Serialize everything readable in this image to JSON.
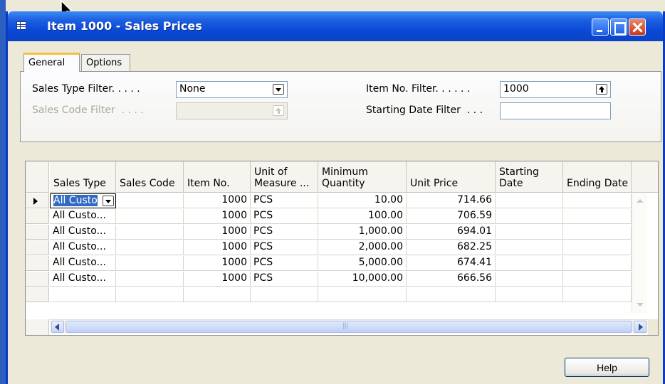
{
  "window": {
    "title": "Item 1000 - Sales Prices"
  },
  "tabs": [
    {
      "label": "General"
    },
    {
      "label": "Options"
    }
  ],
  "filters": {
    "sales_type_label": "Sales Type Filter. . . . .",
    "sales_type_value": "None",
    "sales_code_label": "Sales Code Filter  . . . .",
    "sales_code_value": "",
    "item_no_label": "Item No. Filter. . . . . .",
    "item_no_value": "1000",
    "starting_date_label": "Starting Date Filter  . . .",
    "starting_date_value": ""
  },
  "table": {
    "columns": [
      "Sales Type",
      "Sales Code",
      "Item No.",
      "Unit of\nMeasure ...",
      "Minimum\nQuantity",
      "Unit Price",
      "Starting\nDate",
      "Ending Date"
    ],
    "rows": [
      {
        "sales_type": "All Custo",
        "sales_code": "",
        "item_no": "1000",
        "uom": "PCS",
        "min_qty": "10.00",
        "unit_price": "714.66",
        "starting_date": "",
        "ending_date": ""
      },
      {
        "sales_type": "All Custo...",
        "sales_code": "",
        "item_no": "1000",
        "uom": "PCS",
        "min_qty": "100.00",
        "unit_price": "706.59",
        "starting_date": "",
        "ending_date": ""
      },
      {
        "sales_type": "All Custo...",
        "sales_code": "",
        "item_no": "1000",
        "uom": "PCS",
        "min_qty": "1,000.00",
        "unit_price": "694.01",
        "starting_date": "",
        "ending_date": ""
      },
      {
        "sales_type": "All Custo...",
        "sales_code": "",
        "item_no": "1000",
        "uom": "PCS",
        "min_qty": "2,000.00",
        "unit_price": "682.25",
        "starting_date": "",
        "ending_date": ""
      },
      {
        "sales_type": "All Custo...",
        "sales_code": "",
        "item_no": "1000",
        "uom": "PCS",
        "min_qty": "5,000.00",
        "unit_price": "674.41",
        "starting_date": "",
        "ending_date": ""
      },
      {
        "sales_type": "All Custo...",
        "sales_code": "",
        "item_no": "1000",
        "uom": "PCS",
        "min_qty": "10,000.00",
        "unit_price": "666.56",
        "starting_date": "",
        "ending_date": ""
      }
    ]
  },
  "buttons": {
    "help": "Help"
  },
  "colors": {
    "titlebar": "#0a49d6",
    "selection": "#316ac5",
    "tab_accent": "#f3c042"
  },
  "icons": [
    "table-icon",
    "minimize-icon",
    "maximize-icon",
    "close-icon",
    "dropdown-icon",
    "lookup-icon",
    "row-indicator-icon",
    "mouse-cursor-icon"
  ]
}
